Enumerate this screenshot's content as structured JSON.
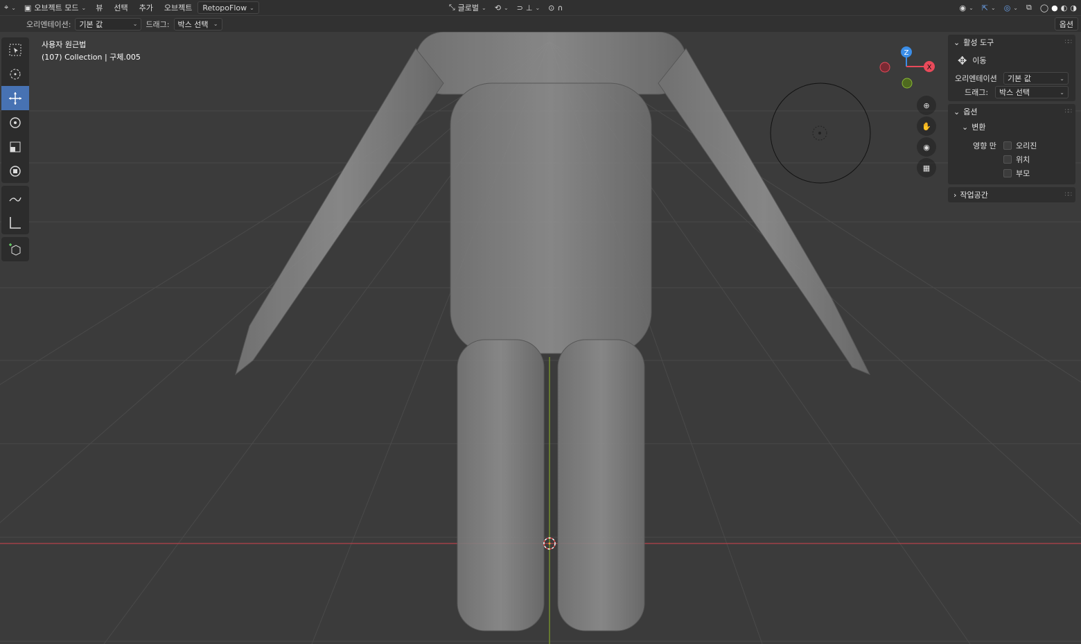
{
  "header": {
    "editor_icon": "viewport-editor-icon",
    "mode_label": "오브젝트 모드",
    "menus": [
      "뷰",
      "선택",
      "추가",
      "오브젝트"
    ],
    "addon_menu": "RetopoFlow",
    "transform_orientation": "글로벌"
  },
  "toolsettings": {
    "orientation_label": "오리엔테이션:",
    "orientation_value": "기본 값",
    "drag_label": "드래그:",
    "drag_value": "박스 선택",
    "options_button": "옵션"
  },
  "toolbar": {
    "tools": [
      "select-box-icon",
      "cursor-icon",
      "move-icon",
      "rotate-icon",
      "scale-icon",
      "transform-icon",
      "annotate-icon",
      "measure-icon",
      "add-cube-icon"
    ],
    "active_tool": "move-icon"
  },
  "overlay": {
    "view_name": "사용자 원근법",
    "collection_info": "(107) Collection | 구체.005"
  },
  "gizmo": {
    "axes": [
      "Z",
      "X"
    ],
    "colors": {
      "x": "#e94a5a",
      "y": "#8ab935",
      "z": "#3b8ee8"
    }
  },
  "npanel": {
    "active_tool_title": "활성 도구",
    "active_tool_name": "이동",
    "orientation_label": "오리엔테이션",
    "orientation_value": "기본 값",
    "drag_label": "드래그:",
    "drag_value": "박스 선택",
    "options_title": "옵션",
    "transform_title": "변환",
    "affect_only_label": "영향 만",
    "affect_items": [
      "오리진",
      "위치",
      "부모"
    ],
    "workspace_title": "작업공간"
  },
  "scene": {
    "object_description": "sculpted figure mesh (placeholder)"
  },
  "colors": {
    "accent": "#4772b3",
    "x_axis_line": "#b5424a",
    "y_axis_line": "#7fa02a"
  }
}
